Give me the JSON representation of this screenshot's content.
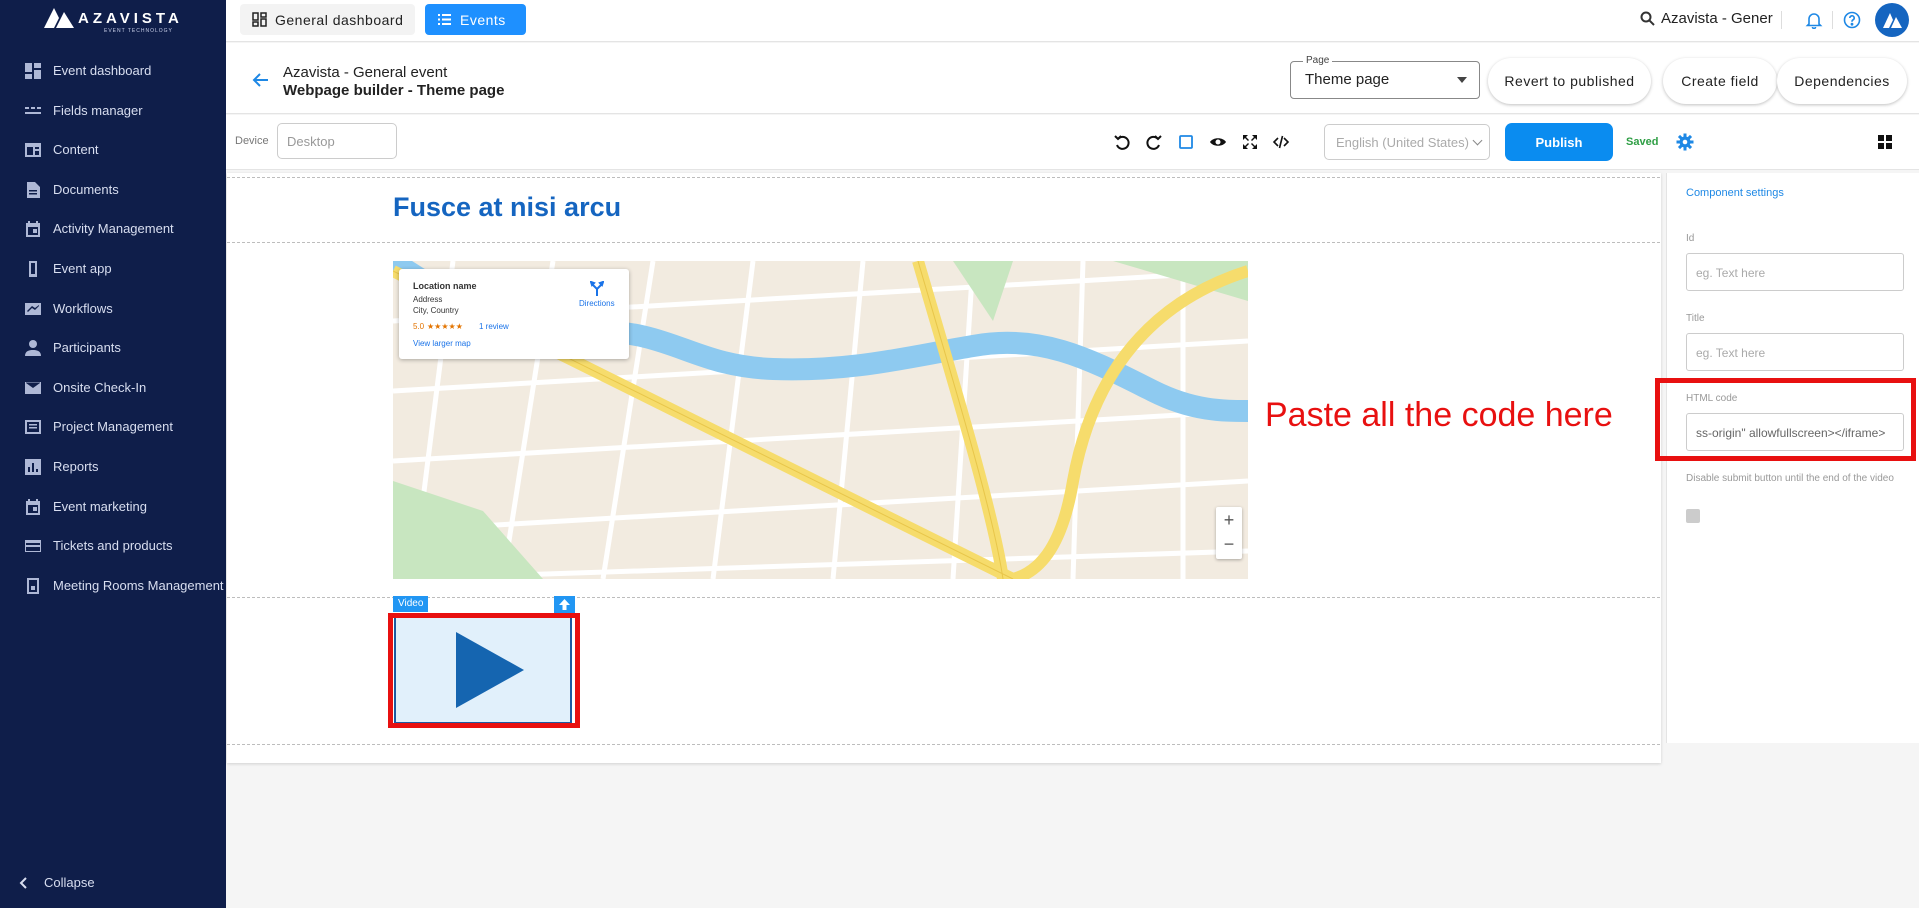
{
  "brand": {
    "name": "AZAVISTA",
    "tagline": "EVENT TECHNOLOGY"
  },
  "sidebar": {
    "items": [
      {
        "label": "Event dashboard",
        "icon": "dashboard-icon"
      },
      {
        "label": "Fields manager",
        "icon": "fields-icon"
      },
      {
        "label": "Content",
        "icon": "content-icon"
      },
      {
        "label": "Documents",
        "icon": "document-icon"
      },
      {
        "label": "Activity Management",
        "icon": "calendar-icon"
      },
      {
        "label": "Event app",
        "icon": "phone-icon"
      },
      {
        "label": "Workflows",
        "icon": "workflow-icon"
      },
      {
        "label": "Participants",
        "icon": "person-icon"
      },
      {
        "label": "Onsite Check-In",
        "icon": "mail-icon"
      },
      {
        "label": "Project Management",
        "icon": "project-icon"
      },
      {
        "label": "Reports",
        "icon": "reports-icon"
      },
      {
        "label": "Event marketing",
        "icon": "calendar-icon"
      },
      {
        "label": "Tickets and products",
        "icon": "card-icon"
      },
      {
        "label": "Meeting Rooms Management",
        "icon": "room-icon"
      }
    ],
    "collapse_label": "Collapse"
  },
  "topbar": {
    "general_dashboard": "General dashboard",
    "events": "Events",
    "search_text": "Azavista - Gener"
  },
  "header": {
    "event_name": "Azavista - General event",
    "subtitle": "Webpage builder - Theme page",
    "page_label": "Page",
    "page_value": "Theme page",
    "revert": "Revert to published",
    "create_field": "Create field",
    "dependencies": "Dependencies"
  },
  "toolbar": {
    "device_label": "Device",
    "device_value": "Desktop",
    "language": "English (United States)",
    "publish": "Publish",
    "saved": "Saved"
  },
  "canvas": {
    "heading": "Fusce at nisi arcu",
    "map_card": {
      "name": "Location name",
      "address": "Address",
      "city": "City, Country",
      "rating": "5.0",
      "stars": "★★★★★",
      "reviews": "1 review",
      "directions": "Directions",
      "larger_map": "View larger map"
    },
    "video_label": "Video"
  },
  "panel": {
    "title": "Component settings",
    "id_label": "Id",
    "id_placeholder": "eg. Text here",
    "title_label": "Title",
    "title_placeholder": "eg. Text here",
    "html_label": "HTML code",
    "html_value": "ss-origin\" allowfullscreen></iframe>",
    "disable_label": "Disable submit button until the end of the video"
  },
  "annotation": {
    "text": "Paste all the code here"
  },
  "colors": {
    "sidebar": "#0f1e4a",
    "primary": "#1e90ff",
    "annotation": "#e81010",
    "heading": "#1565c0"
  }
}
